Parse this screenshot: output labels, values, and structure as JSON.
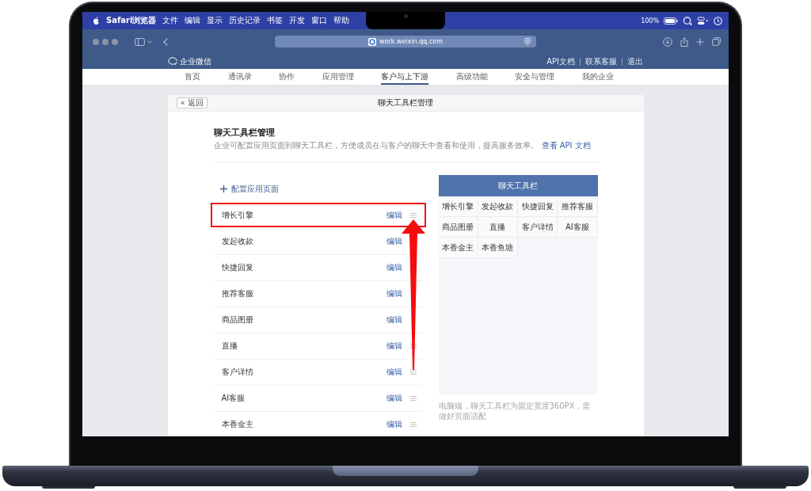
{
  "menu_bar": {
    "app": "Safari浏览器",
    "items": [
      "文件",
      "编辑",
      "显示",
      "历史记录",
      "书签",
      "开发",
      "窗口",
      "帮助"
    ],
    "battery": "100%"
  },
  "browser": {
    "url": "work.weixin.qq.com"
  },
  "site_header": {
    "logo": "企业微信",
    "links": [
      "API文档",
      "联系客服",
      "退出"
    ]
  },
  "nav": [
    {
      "label": "首页",
      "selected": false
    },
    {
      "label": "通讯录",
      "selected": false
    },
    {
      "label": "协作",
      "selected": false
    },
    {
      "label": "应用管理",
      "selected": false
    },
    {
      "label": "客户与上下游",
      "selected": true
    },
    {
      "label": "高级功能",
      "selected": false
    },
    {
      "label": "安全与管理",
      "selected": false
    },
    {
      "label": "我的企业",
      "selected": false
    }
  ],
  "page": {
    "back": "« 返回",
    "title": "聊天工具栏管理"
  },
  "section": {
    "title": "聊天工具栏管理",
    "description": "企业可配置应用页面到聊天工具栏，方便成员在与客户的聊天中查看和使用，提高服务效率。",
    "link": "查看 API 文档",
    "add": "配置应用页面"
  },
  "apps": [
    {
      "name": "增长引擎",
      "action": "编辑",
      "drag_handle": true,
      "outlined": true,
      "arrow_tip": true,
      "arrow_tail": false
    },
    {
      "name": "发起收款",
      "action": "编辑",
      "drag_handle": false,
      "outlined": false,
      "arrow_tip": false,
      "arrow_tail": false
    },
    {
      "name": "快捷回复",
      "action": "编辑",
      "drag_handle": false,
      "outlined": false,
      "arrow_tip": false,
      "arrow_tail": false
    },
    {
      "name": "推荐客服",
      "action": "编辑",
      "drag_handle": false,
      "outlined": false,
      "arrow_tip": false,
      "arrow_tail": false
    },
    {
      "name": "商品图册",
      "action": "编辑",
      "drag_handle": false,
      "outlined": false,
      "arrow_tip": false,
      "arrow_tail": false
    },
    {
      "name": "直播",
      "action": "编辑",
      "drag_handle": true,
      "outlined": false,
      "arrow_tip": false,
      "arrow_tail": false
    },
    {
      "name": "客户详情",
      "action": "编辑",
      "drag_handle": true,
      "outlined": false,
      "arrow_tip": false,
      "arrow_tail": true
    },
    {
      "name": "AI客服",
      "action": "编辑",
      "drag_handle": true,
      "outlined": false,
      "arrow_tip": false,
      "arrow_tail": false
    },
    {
      "name": "本香金主",
      "action": "编辑",
      "drag_handle": true,
      "outlined": false,
      "arrow_tip": false,
      "arrow_tail": false
    }
  ],
  "preview": {
    "title": "聊天工具栏",
    "items": [
      "增长引擎",
      "发起收款",
      "快捷回复",
      "推荐客服",
      "商品图册",
      "直播",
      "客户详情",
      "AI客服",
      "本香金主",
      "本香鱼塘"
    ],
    "note": "电脑端，聊天工具栏为固定宽度360PX，需做好页面适配"
  }
}
